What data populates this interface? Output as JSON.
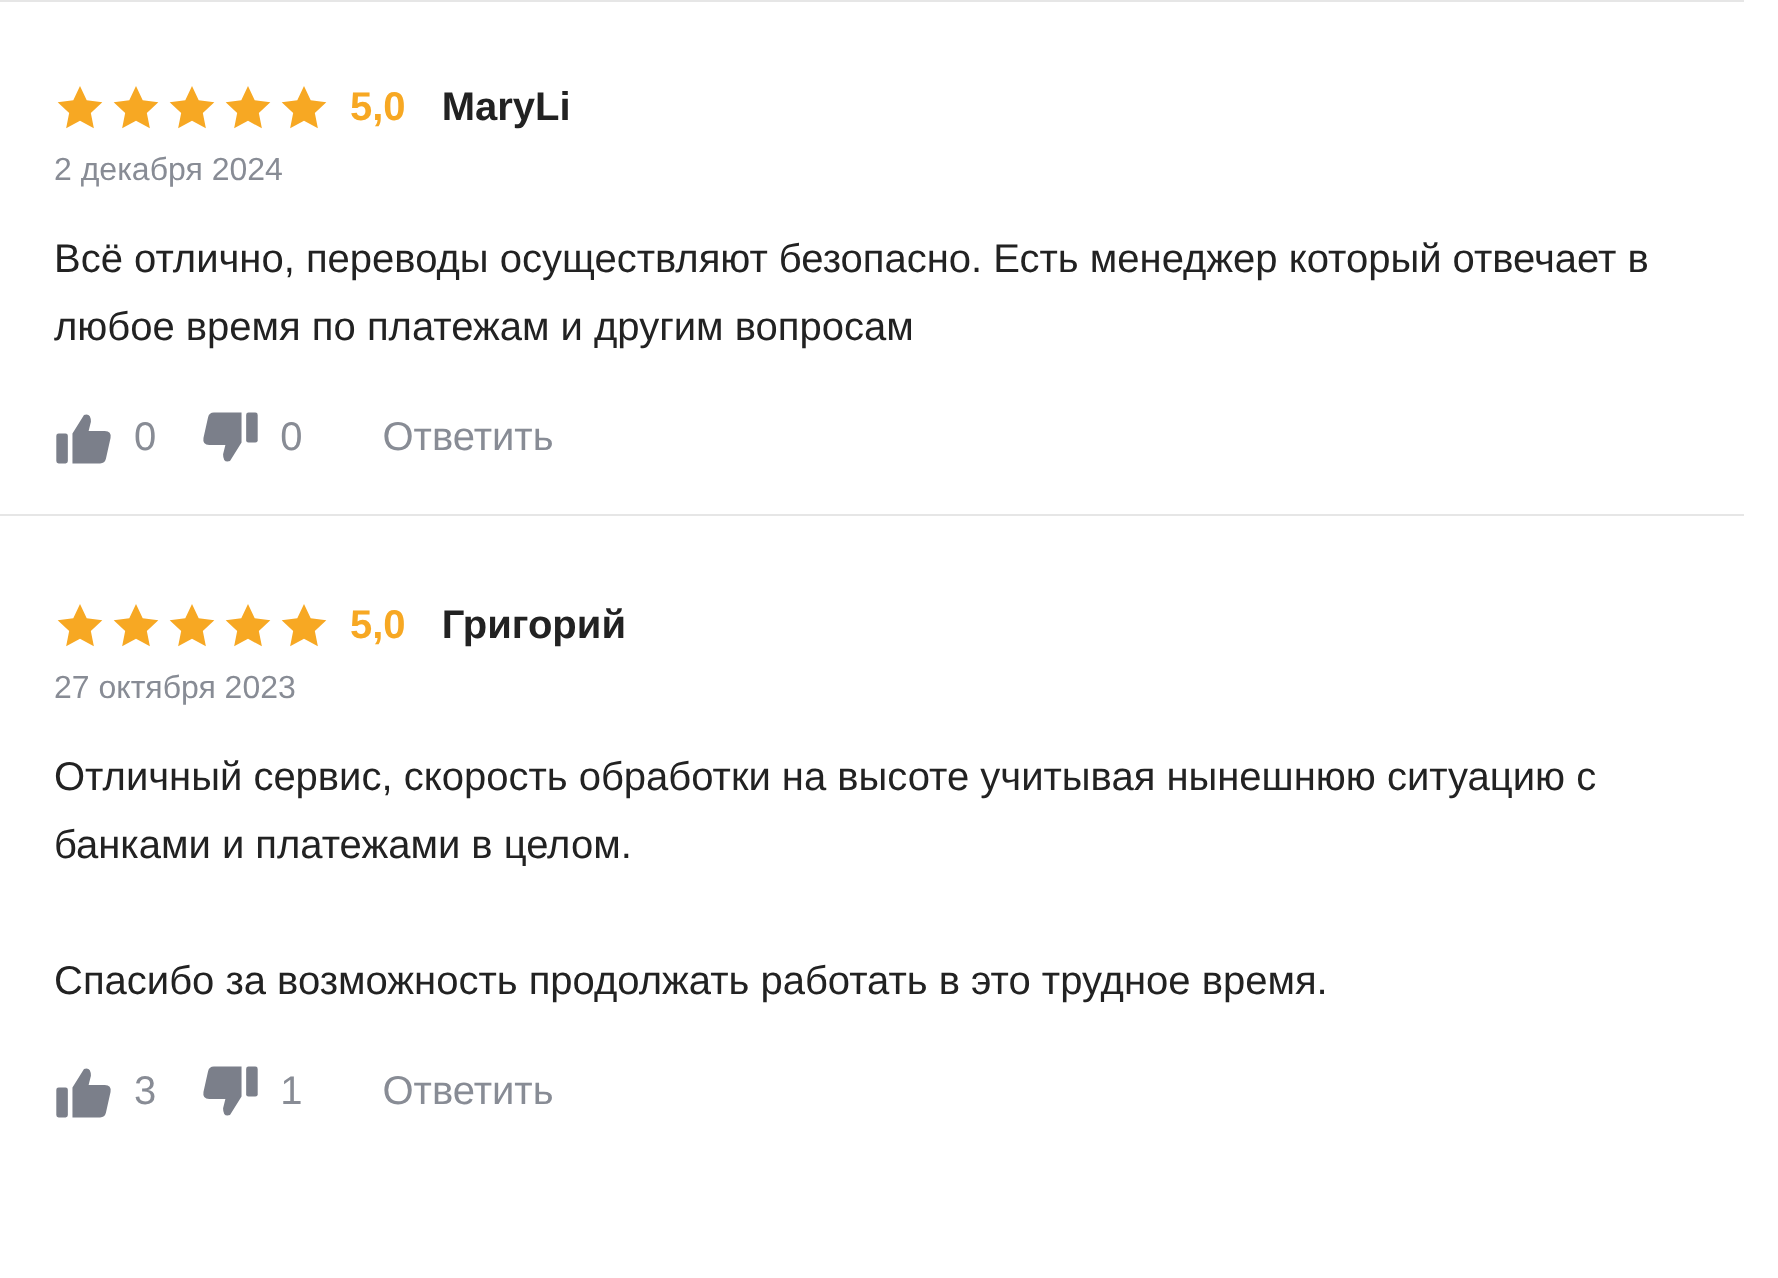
{
  "reviews": [
    {
      "stars": 5,
      "rating": "5,0",
      "author": "MaryLi",
      "date": "2 декабря 2024",
      "paragraphs": [
        "Всё отлично, переводы осуществляют безопасно. Есть менеджер который отвечает в любое время по платежам и другим вопросам"
      ],
      "likes": "0",
      "dislikes": "0",
      "reply": "Ответить"
    },
    {
      "stars": 5,
      "rating": "5,0",
      "author": "Григорий",
      "date": "27 октября 2023",
      "paragraphs": [
        "Отличный сервис, скорость обработки на высоте учитывая нынешнюю ситуацию с банками и платежами в целом.",
        "Спасибо за возможность продолжать работать в это трудное время."
      ],
      "likes": "3",
      "dislikes": "1",
      "reply": "Ответить"
    }
  ]
}
